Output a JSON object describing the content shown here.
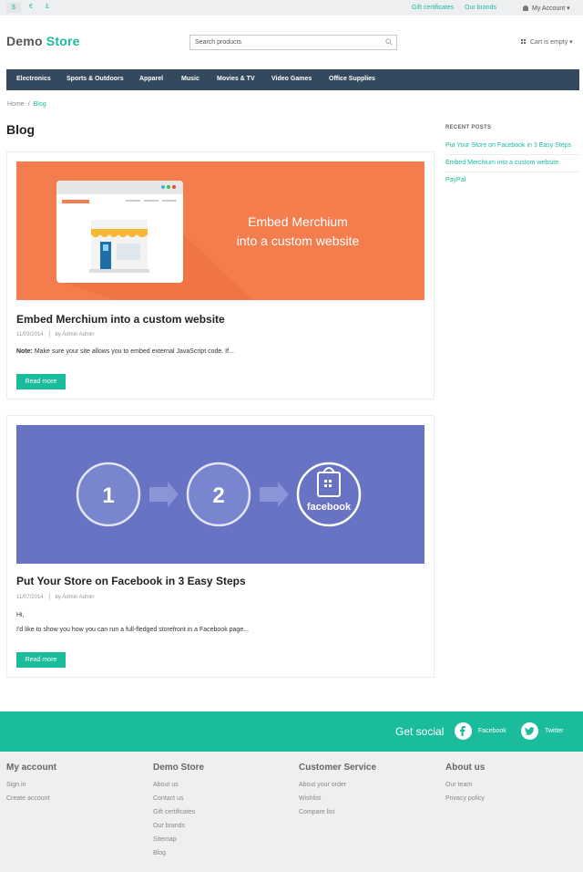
{
  "topbar": {
    "currencies": [
      "$",
      "€",
      "£"
    ],
    "links": [
      "Gift certificates",
      "Our brands"
    ],
    "account": "My Account ▾"
  },
  "header": {
    "logo_main": "Demo",
    "logo_accent": "Store",
    "search_placeholder": "Search products",
    "cart": "Cart is empty ▾"
  },
  "nav": [
    "Electronics",
    "Sports & Outdoors",
    "Apparel",
    "Music",
    "Movies & TV",
    "Video Games",
    "Office Supplies"
  ],
  "breadcrumb": {
    "home": "Home",
    "sep": "/",
    "current": "Blog"
  },
  "page_title": "Blog",
  "posts": [
    {
      "image_text_line1": "Embed Merchium",
      "image_text_line2": "into a custom website",
      "title": "Embed Merchium into a custom website",
      "date": "11/09/2014",
      "author": "by Admin Admin",
      "excerpt_bold": "Note:",
      "excerpt": " Make sure your site allows you to embed external JavaScript code. If...",
      "button": "Read more"
    },
    {
      "step1": "1",
      "step2": "2",
      "step3": "facebook",
      "title": "Put Your Store on Facebook in 3 Easy Steps",
      "date": "11/07/2014",
      "author": "by Admin Admin",
      "excerpt_line1": "Hi,",
      "excerpt": "I'd like to show you how you can run a full-fledged storefront in a Facebook page...",
      "button": "Read more"
    }
  ],
  "sidebar": {
    "title": "Recent posts",
    "items": [
      "Put Your Store on Facebook in 3 Easy Steps",
      "Embed Merchium into a custom website",
      "PayPal"
    ]
  },
  "social": {
    "heading": "Get social",
    "facebook": "Facebook",
    "twitter": "Twitter"
  },
  "footer": [
    {
      "heading": "My account",
      "links": [
        "Sign in",
        "Create account"
      ]
    },
    {
      "heading": "Demo Store",
      "links": [
        "About us",
        "Contact us",
        "Gift certificates",
        "Our brands",
        "Sitemap",
        "Blog"
      ]
    },
    {
      "heading": "Customer Service",
      "links": [
        "About your order",
        "Wishlist",
        "Compare list"
      ]
    },
    {
      "heading": "About us",
      "links": [
        "Our team",
        "Privacy policy"
      ]
    }
  ],
  "colors": {
    "accent": "#1abc9c",
    "nav": "#34495e",
    "orange": "#f47d4e",
    "purple": "#6873c4"
  }
}
